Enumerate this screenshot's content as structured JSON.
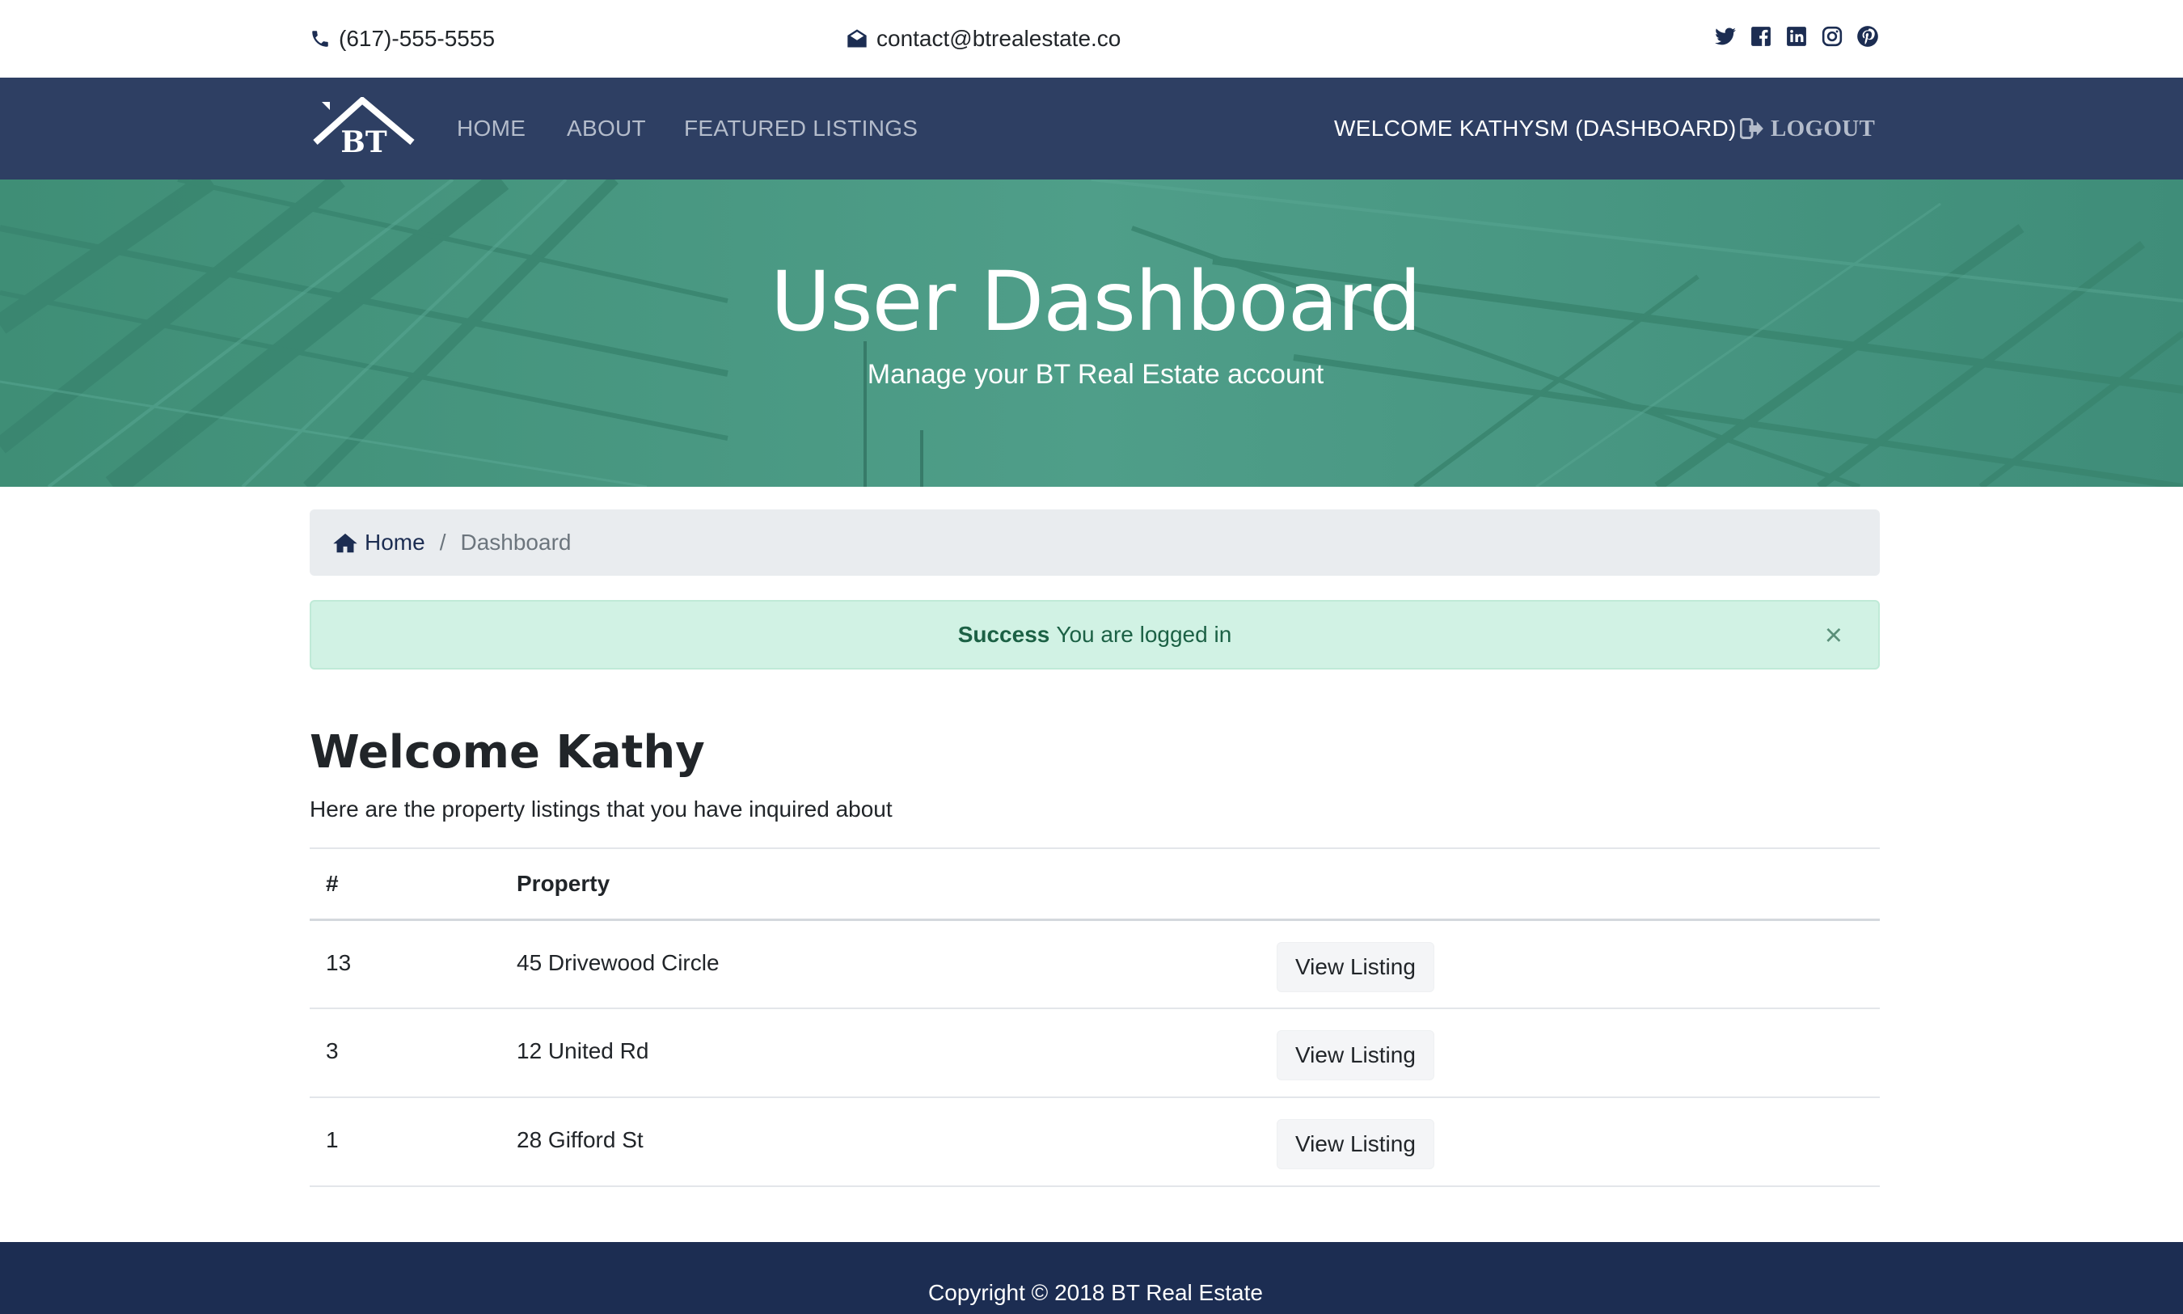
{
  "topbar": {
    "phone": "(617)-555-5555",
    "email": "contact@btrealestate.co",
    "social": [
      "twitter-icon",
      "facebook-icon",
      "linkedin-icon",
      "instagram-icon",
      "pinterest-icon"
    ]
  },
  "navbar": {
    "logo_text": "BT",
    "links": {
      "home": "HOME",
      "about": "ABOUT",
      "featured": "FEATURED LISTINGS"
    },
    "welcome": "WELCOME KATHYSM (DASHBOARD)",
    "logout": "LOGOUT"
  },
  "hero": {
    "title": "User Dashboard",
    "subtitle": "Manage your BT Real Estate account"
  },
  "breadcrumb": {
    "home": "Home",
    "separator": "/",
    "current": "Dashboard"
  },
  "alert": {
    "strong": "Success",
    "message": "You are logged in",
    "close": "×"
  },
  "main": {
    "title": "Welcome Kathy",
    "subtitle": "Here are the property listings that you have inquired about",
    "table": {
      "headers": [
        "#",
        "Property",
        ""
      ],
      "rows": [
        {
          "id": "13",
          "property": "45 Drivewood Circle",
          "action": "View Listing"
        },
        {
          "id": "3",
          "property": "12 United Rd",
          "action": "View Listing"
        },
        {
          "id": "1",
          "property": "28 Gifford St",
          "action": "View Listing"
        }
      ]
    }
  },
  "footer": {
    "copyright": "Copyright © 2018 BT Real Estate"
  },
  "colors": {
    "navbar": "#2e3f63",
    "hero": "#4e9c87",
    "footer": "#1c2d52",
    "alert_bg": "#d1f2e4"
  }
}
